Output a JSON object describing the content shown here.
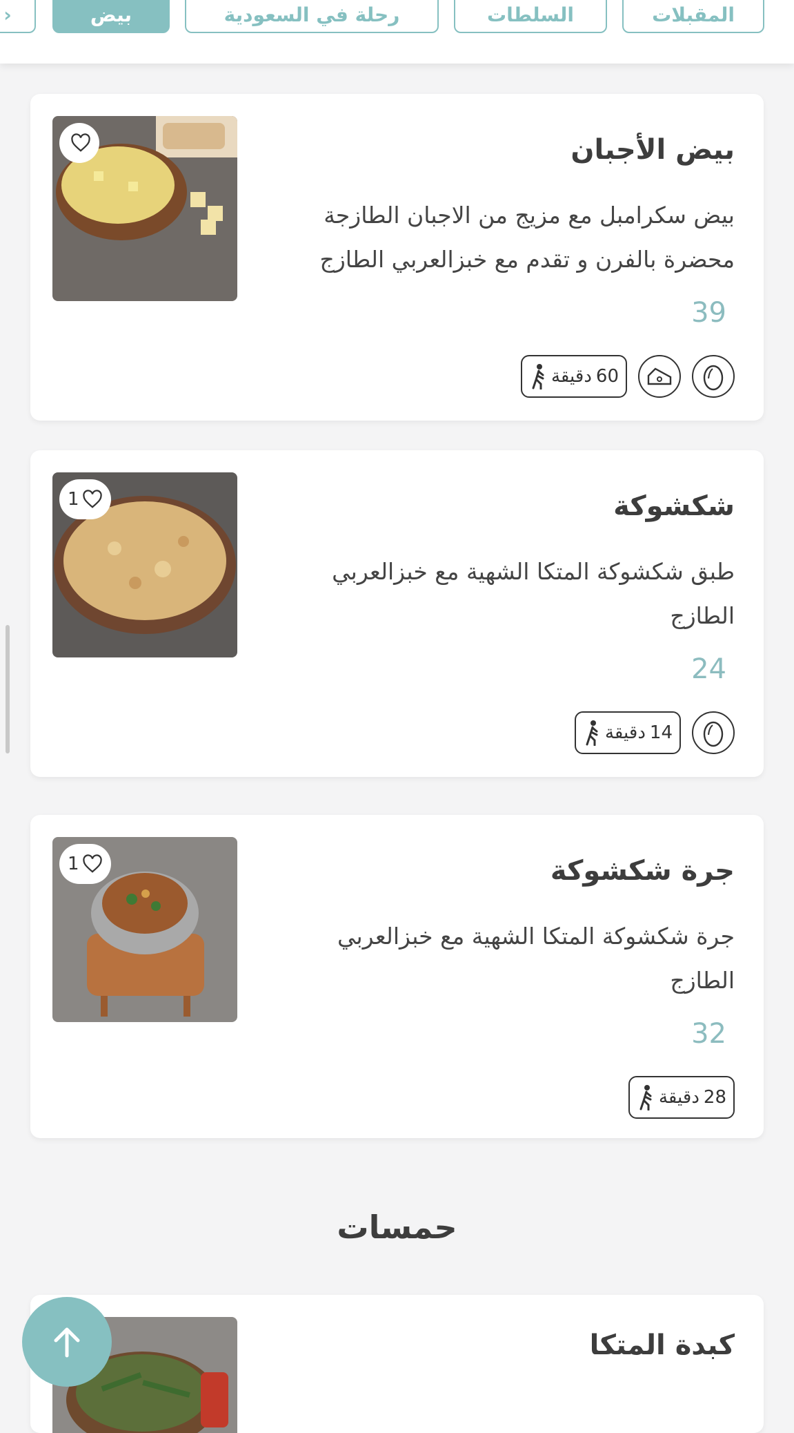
{
  "categories": [
    {
      "label": "المقبلات",
      "active": false
    },
    {
      "label": "السلطات",
      "active": false
    },
    {
      "label": "رحلة في السعودية",
      "active": false
    },
    {
      "label": "بيض",
      "active": true
    }
  ],
  "items": [
    {
      "title": "بيض الأجبان",
      "description": "بيض سكرامبل مع مزيج من الاجبان الطازجة محضرة بالفرن و تقدم مع خبزالعربي الطازج",
      "price": "39",
      "favorites": "",
      "time_value": "60",
      "time_unit": "دقيقة",
      "icons": [
        "egg-icon",
        "cheese-icon"
      ]
    },
    {
      "title": "شكشوكة",
      "description": "طبق شكشوكة المتكا الشهية مع خبزالعربي الطازج",
      "price": "24",
      "favorites": "1",
      "time_value": "14",
      "time_unit": "دقيقة",
      "icons": [
        "egg-icon"
      ]
    },
    {
      "title": "جرة شكشوكة",
      "description": "جرة شكشوكة المتكا الشهية مع خبزالعربي الطازج",
      "price": "32",
      "favorites": "1",
      "time_value": "28",
      "time_unit": "دقيقة",
      "icons": []
    },
    {
      "title": "كبدة المتكا",
      "description": "",
      "price": "",
      "favorites": "",
      "time_value": "",
      "time_unit": "",
      "icons": []
    }
  ],
  "section_title": "حمسات",
  "colors": {
    "accent": "#86c0c1",
    "price": "#8cbcbf",
    "background": "#f4f4f5"
  }
}
